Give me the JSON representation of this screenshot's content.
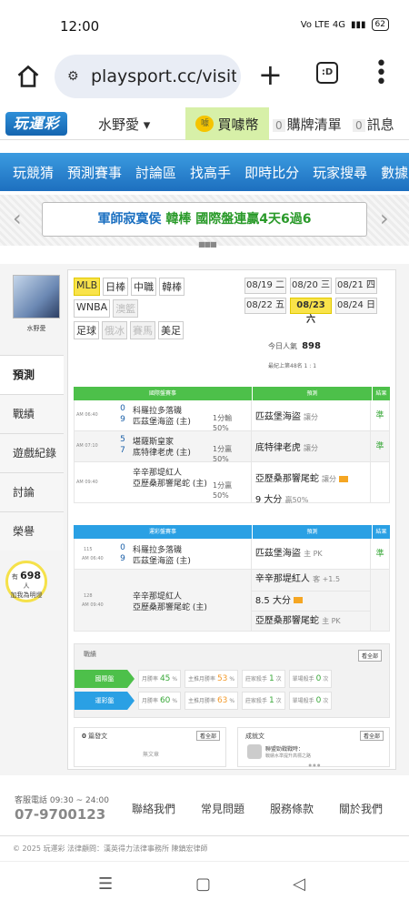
{
  "status": {
    "time": "12:00",
    "signal": "Vo LTE 4G",
    "battery": "62"
  },
  "browser": {
    "url": "playsport.cc/visit",
    "tabs_label": ":D"
  },
  "site": {
    "logo": "玩運彩",
    "user": "水野愛 ▾",
    "buy_coin": "買噱幣",
    "cart_count": "0",
    "cart": "購牌清單",
    "msg_count": "0",
    "msg": "訊息"
  },
  "nav": [
    "玩競猜",
    "預測賽事",
    "討論區",
    "找高手",
    "即時比分",
    "玩家搜尋",
    "數據"
  ],
  "marquee": {
    "prefix": "軍師寂寞侯 ",
    "highlight": "韓棒 國際盤連贏4天6過6",
    "left": "‹",
    "right": "›"
  },
  "profile": {
    "name": "水野愛"
  },
  "side_tabs": [
    "預測",
    "戰績",
    "遊戲紀錄",
    "討論",
    "榮譽"
  ],
  "followers": {
    "prefix": "有",
    "count": "698",
    "suffix": "人",
    "line2": "加我為明燈"
  },
  "leagues": [
    [
      {
        "t": "MLB",
        "s": "sel"
      },
      {
        "t": "日棒",
        "s": ""
      },
      {
        "t": "中職",
        "s": ""
      },
      {
        "t": "韓棒",
        "s": ""
      }
    ],
    [
      {
        "t": "WNBA",
        "s": ""
      },
      {
        "t": "澳籃",
        "s": "dis"
      }
    ],
    [
      {
        "t": "足球",
        "s": ""
      },
      {
        "t": "俄冰",
        "s": "dis"
      },
      {
        "t": "賽馬",
        "s": "dis"
      },
      {
        "t": "美足",
        "s": ""
      }
    ]
  ],
  "dates": [
    {
      "t": "08/19 二",
      "s": ""
    },
    {
      "t": "08/20 三",
      "s": ""
    },
    {
      "t": "08/21 四",
      "s": ""
    },
    {
      "t": "08/22 五",
      "s": ""
    },
    {
      "t": "08/23 六",
      "s": "sel"
    },
    {
      "t": "08/24 日",
      "s": ""
    }
  ],
  "today_pop": {
    "label": "今日人氣",
    "value": "898"
  },
  "rank": "最紀上第48名 1 : 1",
  "intl": {
    "headers": [
      "國際盤賽事",
      "預測",
      "結果"
    ],
    "rows": [
      {
        "time": "AM 06:40",
        "s1": "0",
        "s2": "9",
        "t1": "科羅拉多落磯",
        "t2": "匹茲堡海盜 (主)",
        "hc": "1分輸",
        "hc2": "50%",
        "pick": "匹茲堡海盜",
        "pick_note": "讓分",
        "result": "準"
      },
      {
        "time": "AM 07:10",
        "s1": "5",
        "s2": "7",
        "t1": "堪薩斯皇家",
        "t2": "底特律老虎 (主)",
        "hc": "1分贏",
        "hc2": "50%",
        "pick": "底特律老虎",
        "pick_note": "讓分",
        "result": "準"
      },
      {
        "time": "AM 09:40",
        "s1": "",
        "s2": "",
        "t1": "辛辛那堤紅人",
        "t2": "亞歷桑那響尾蛇 (主)",
        "hc": "1分贏",
        "hc2": "50%",
        "pick": "亞歷桑那響尾蛇",
        "pick_note": "讓分",
        "pick2": "9 大分",
        "pick2_note": "贏50%",
        "result": ""
      }
    ]
  },
  "lottery": {
    "headers": [
      "運彩盤賽事",
      "預測",
      "結果"
    ],
    "rows": [
      {
        "num": "115",
        "time": "AM 06:40",
        "s1": "0",
        "s2": "9",
        "t1": "科羅拉多落磯",
        "t2": "匹茲堡海盜 (主)",
        "picks": [
          {
            "p": "匹茲堡海盜",
            "n": "主 PK"
          }
        ],
        "result": "準"
      },
      {
        "num": "128",
        "time": "AM 09:40",
        "s1": "",
        "s2": "",
        "t1": "辛辛那堤紅人",
        "t2": "亞歷桑那響尾蛇 (主)",
        "picks": [
          {
            "p": "辛辛那堤紅人",
            "n": "客 +1.5"
          },
          {
            "p": "8.5 大分",
            "n": ""
          },
          {
            "p": "亞歷桑那響尾蛇",
            "n": "主 PK"
          }
        ],
        "result": ""
      }
    ]
  },
  "performance": {
    "title": "戰績",
    "more": "看全部",
    "rows": [
      {
        "label": "國際盤",
        "color": "#4dc04a",
        "c1l": "月勝率",
        "c1v": "45",
        "c1u": "%",
        "c2l": "主推月勝率",
        "c2v": "53",
        "c2u": "%",
        "c3l": "莊家殺手",
        "c3v": "1",
        "c3u": "次",
        "c4l": "單場殺手",
        "c4v": "0",
        "c4u": "次"
      },
      {
        "label": "運彩盤",
        "color": "#2aa0e4",
        "c1l": "月勝率",
        "c1v": "60",
        "c1u": "%",
        "c2l": "主推月勝率",
        "c2v": "63",
        "c2u": "%",
        "c3l": "莊家殺手",
        "c3v": "1",
        "c3u": "次",
        "c4l": "單場殺手",
        "c4v": "0",
        "c4u": "次"
      }
    ]
  },
  "posts": {
    "count": "0",
    "label": "篇發文",
    "more": "看全部",
    "empty": "無文章"
  },
  "badges": {
    "label": "成就文",
    "more": "看全部",
    "item_title": "聯盟勁戰戰時：",
    "item_sub": "戰績水準提升高標之路",
    "dots": "● ● ●"
  },
  "footer": {
    "service": "客服電話 09:30 ~ 24:00",
    "phone": "07-9700123",
    "links": [
      "聯絡我們",
      "常見問題",
      "服務條款",
      "關於我們"
    ],
    "copyright": "© 2025 玩運彩 法律顧問：漢英得力法律事務所 陳鎮宏律師"
  },
  "sysnav": {
    "menu": "☰",
    "home": "▢",
    "back": "◁"
  }
}
